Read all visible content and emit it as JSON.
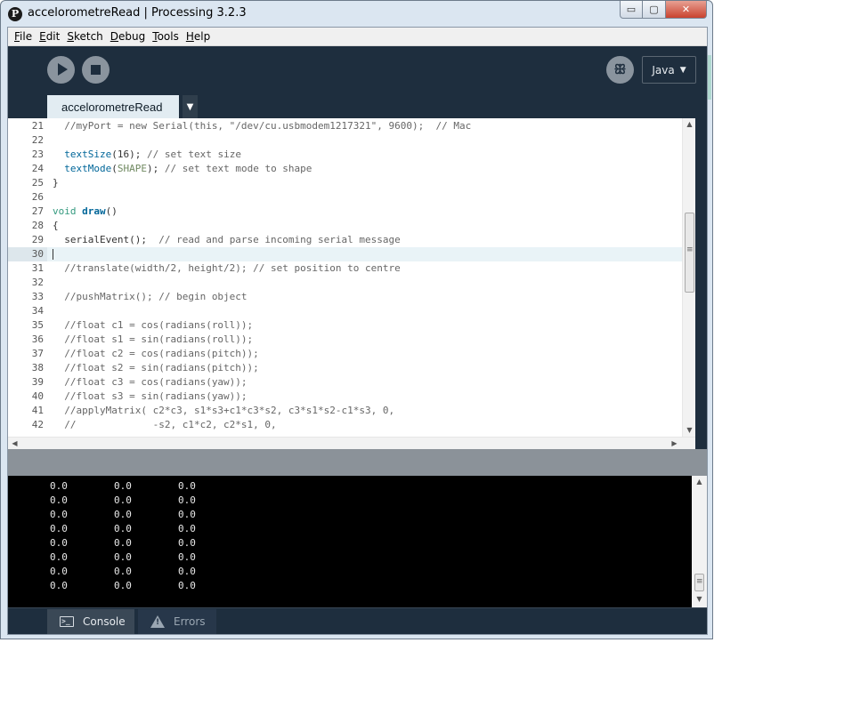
{
  "window": {
    "app_icon": "P",
    "title": "accelorometreRead | Processing 3.2.3",
    "controls": {
      "minimize": "▭",
      "maximize": "▢",
      "close": "✕"
    }
  },
  "menu": {
    "items": [
      {
        "u": "F",
        "rest": "ile"
      },
      {
        "u": "E",
        "rest": "dit"
      },
      {
        "u": "S",
        "rest": "ketch"
      },
      {
        "u": "D",
        "rest": "ebug"
      },
      {
        "u": "T",
        "rest": "ools"
      },
      {
        "u": "H",
        "rest": "elp"
      }
    ]
  },
  "toolbar": {
    "run_icon": "play-icon",
    "stop_icon": "stop-icon",
    "debug_icon": "butterfly-icon",
    "debug_glyph": "ꕥ",
    "mode_label": "Java",
    "mode_arrow": "▼"
  },
  "tabs": {
    "active_tab": "accelorometreRead",
    "menu_arrow": "▼"
  },
  "editor": {
    "lines": [
      {
        "n": "21",
        "t": "  //myPort = new Serial(this, \"/dev/cu.usbmodem1217321\", 9600);  // Mac"
      },
      {
        "n": "22",
        "t": ""
      },
      {
        "n": "23",
        "t": "  textSize(16); // set text size"
      },
      {
        "n": "24",
        "t": "  textMode(SHAPE); // set text mode to shape"
      },
      {
        "n": "25",
        "t": "}"
      },
      {
        "n": "26",
        "t": ""
      },
      {
        "n": "27",
        "t": "void draw()"
      },
      {
        "n": "28",
        "t": "{"
      },
      {
        "n": "29",
        "t": "  serialEvent();  // read and parse incoming serial message"
      },
      {
        "n": "30",
        "t": ""
      },
      {
        "n": "31",
        "t": "  //translate(width/2, height/2); // set position to centre"
      },
      {
        "n": "32",
        "t": ""
      },
      {
        "n": "33",
        "t": "  //pushMatrix(); // begin object"
      },
      {
        "n": "34",
        "t": ""
      },
      {
        "n": "35",
        "t": "  //float c1 = cos(radians(roll));"
      },
      {
        "n": "36",
        "t": "  //float s1 = sin(radians(roll));"
      },
      {
        "n": "37",
        "t": "  //float c2 = cos(radians(pitch));"
      },
      {
        "n": "38",
        "t": "  //float s2 = sin(radians(pitch));"
      },
      {
        "n": "39",
        "t": "  //float c3 = cos(radians(yaw));"
      },
      {
        "n": "40",
        "t": "  //float s3 = sin(radians(yaw));"
      },
      {
        "n": "41",
        "t": "  //applyMatrix( c2*c3, s1*s3+c1*c3*s2, c3*s1*s2-c1*s3, 0,"
      },
      {
        "n": "42",
        "t": "  //             -s2, c1*c2, c2*s1, 0,"
      }
    ],
    "current_line": "30",
    "scroll_up": "▲",
    "scroll_down": "▼",
    "scroll_left": "◀",
    "scroll_right": "▶"
  },
  "console": {
    "rows": [
      [
        "0.0",
        "0.0",
        "0.0"
      ],
      [
        "0.0",
        "0.0",
        "0.0"
      ],
      [
        "0.0",
        "0.0",
        "0.0"
      ],
      [
        "0.0",
        "0.0",
        "0.0"
      ],
      [
        "0.0",
        "0.0",
        "0.0"
      ],
      [
        "0.0",
        "0.0",
        "0.0"
      ],
      [
        "0.0",
        "0.0",
        "0.0"
      ],
      [
        "0.0",
        "0.0",
        "0.0"
      ]
    ],
    "scroll_up": "▲",
    "scroll_down": "▼"
  },
  "footer": {
    "console_tab": "Console",
    "errors_tab": "Errors",
    "console_icon": ">_"
  },
  "colors": {
    "toolbar_bg": "#1e2e3e",
    "tab_active_bg": "#e2ecf2",
    "console_bg": "#000000",
    "comment": "#666666",
    "keyword": "#33997e",
    "function": "#006699"
  }
}
